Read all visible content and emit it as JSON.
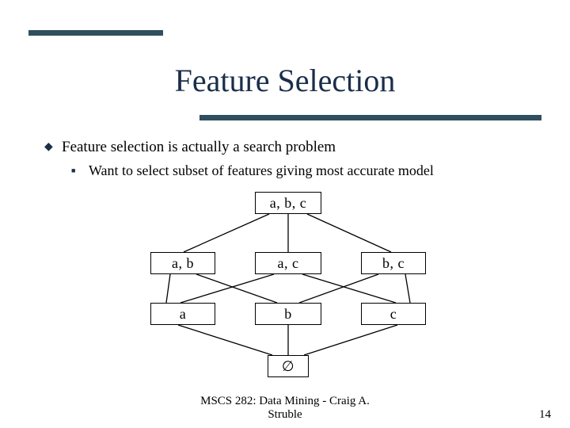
{
  "title": "Feature Selection",
  "bullet1": "Feature selection is actually a search problem",
  "bullet2": "Want to select subset of features giving most accurate model",
  "nodes": {
    "top": "a, b, c",
    "ab": "a, b",
    "ac": "a, c",
    "bc": "b, c",
    "a": "a",
    "b": "b",
    "c": "c",
    "empty": "∅"
  },
  "footer_line1": "MSCS 282: Data Mining - Craig A.",
  "footer_line2": "Struble",
  "page_number": "14",
  "colors": {
    "bar": "#2f4f5f",
    "title": "#1a2e4a"
  }
}
